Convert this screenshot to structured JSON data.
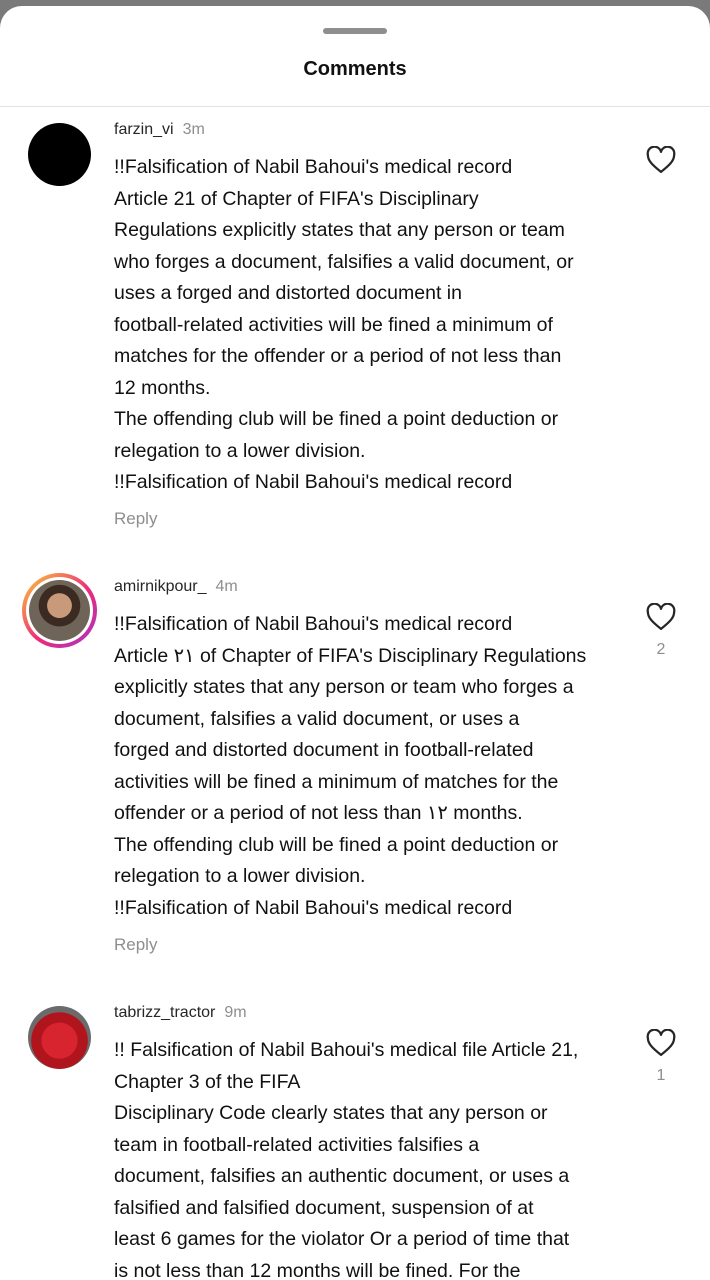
{
  "header": {
    "title": "Comments"
  },
  "comments": [
    {
      "username": "farzin_vi",
      "time": "3m",
      "lines": [
        "!!Falsification of Nabil Bahoui's medical record",
        "Article 21 of Chapter of FIFA's Disciplinary",
        "Regulations explicitly states that any person or team",
        "who forges a document, falsifies a valid document, or",
        "uses a forged and distorted document in",
        "football-related activities will be fined a minimum of",
        "matches for the offender or a period of not less than",
        "12 months.",
        "The offending club will be fined a point deduction or",
        "relegation to a lower division.",
        "!!Falsification of Nabil Bahoui's medical record"
      ],
      "reply_label": "Reply",
      "likes": "",
      "avatar_icon": "avatar-black"
    },
    {
      "username": "amirnikpour_",
      "time": "4m",
      "lines": [
        "!!Falsification of Nabil Bahoui's medical record",
        "Article ۲۱ of Chapter of FIFA's Disciplinary Regulations",
        "explicitly states that any person or team who forges a",
        "document, falsifies a valid document, or uses a",
        "forged and distorted document in football-related",
        "activities will be fined a minimum of matches for the",
        "offender or a period of not less than ۱۲ months.",
        "The offending club will be fined a point deduction or",
        "relegation to a lower division.",
        "!!Falsification of Nabil Bahoui's medical record"
      ],
      "reply_label": "Reply",
      "likes": "2",
      "avatar_icon": "avatar-story-ring"
    },
    {
      "username": "tabrizz_tractor",
      "time": "9m",
      "lines": [
        "!! Falsification of Nabil Bahoui's medical file Article 21,",
        "Chapter 3 of the FIFA",
        "Disciplinary Code clearly states that any person or",
        "team in football-related activities falsifies a",
        "document, falsifies an authentic document, or uses a",
        "falsified and falsified document, suspension of at",
        "least 6 games for the violator Or a period of time that",
        "is not less than 12 months will be fined. For the"
      ],
      "reply_label": "",
      "likes": "1",
      "avatar_icon": "avatar-red-jersey"
    }
  ],
  "colors": {
    "background_dim": "#7a7a7a",
    "sheet": "#ffffff",
    "secondary_text": "#8e8e8e",
    "primary_text": "#111111"
  },
  "icons": {
    "like": "heart-outline-icon"
  }
}
